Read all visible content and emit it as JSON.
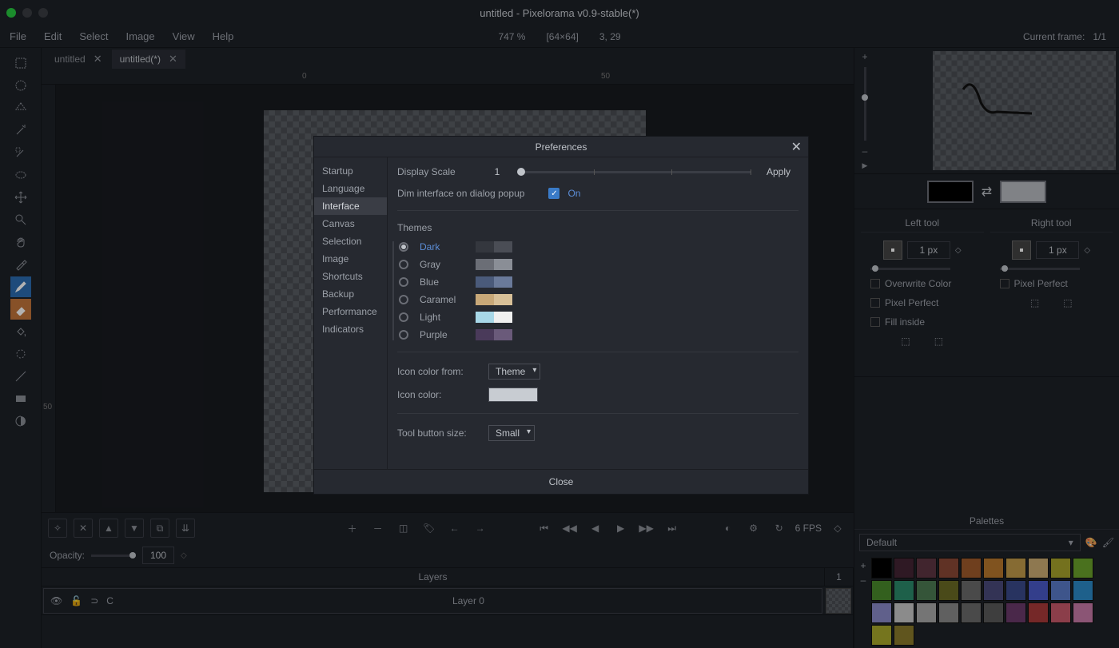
{
  "window": {
    "title": "untitled - Pixelorama v0.9-stable(*)"
  },
  "menu": {
    "file": "File",
    "edit": "Edit",
    "select": "Select",
    "image": "Image",
    "view": "View",
    "help": "Help",
    "zoom": "747 %",
    "dims": "[64×64]",
    "pos": "3, 29",
    "curframe_lbl": "Current frame:",
    "curframe_val": "1/1"
  },
  "tabs": [
    {
      "label": "untitled",
      "active": false
    },
    {
      "label": "untitled(*)",
      "active": true
    }
  ],
  "ruler": {
    "r0": "0",
    "r50": "50",
    "v50": "50"
  },
  "bottom": {
    "opacity_lbl": "Opacity:",
    "opacity_val": "100",
    "fps_lbl": "6 FPS",
    "layers_lbl": "Layers",
    "frame1": "1",
    "layer0": "Layer 0",
    "linkchar": "⊃",
    "chainchar": "C"
  },
  "right": {
    "left_tool": "Left tool",
    "right_tool": "Right tool",
    "px1": "1 px",
    "overwrite": "Overwrite Color",
    "pixel_perfect": "Pixel Perfect",
    "fill_inside": "Fill inside",
    "palettes": "Palettes",
    "default": "Default",
    "plus": "+",
    "minus": "–",
    "play": "▶"
  },
  "dialog": {
    "title": "Preferences",
    "sidebar": [
      "Startup",
      "Language",
      "Interface",
      "Canvas",
      "Selection",
      "Image",
      "Shortcuts",
      "Backup",
      "Performance",
      "Indicators"
    ],
    "selected_idx": 2,
    "display_scale_lbl": "Display Scale",
    "display_scale_val": "1",
    "apply": "Apply",
    "dim_lbl": "Dim interface on dialog popup",
    "on": "On",
    "themes_lbl": "Themes",
    "themes": [
      {
        "name": "Dark",
        "c1": "#34373e",
        "c2": "#4a4d55",
        "sel": true
      },
      {
        "name": "Gray",
        "c1": "#6b6e76",
        "c2": "#8a8e96"
      },
      {
        "name": "Blue",
        "c1": "#4a5a7a",
        "c2": "#6a7a9a"
      },
      {
        "name": "Caramel",
        "c1": "#c8a878",
        "c2": "#d8c098"
      },
      {
        "name": "Light",
        "c1": "#a8d8e8",
        "c2": "#f0f0f0"
      },
      {
        "name": "Purple",
        "c1": "#4a3a5a",
        "c2": "#6a5a7a"
      }
    ],
    "icon_from_lbl": "Icon color from:",
    "icon_from_val": "Theme",
    "icon_color_lbl": "Icon color:",
    "tool_size_lbl": "Tool button size:",
    "tool_size_val": "Small",
    "close": "Close"
  },
  "palette_colors": [
    "#000000",
    "#442434",
    "#5d3643",
    "#8a4836",
    "#a05b2c",
    "#b8772d",
    "#c19a49",
    "#ccad73",
    "#a6a22c",
    "#6aa22c",
    "#4a8a2c",
    "#2c8a6a",
    "#4c7a52",
    "#6a6a24",
    "#6a6a6a",
    "#4a4a7a",
    "#3a4a8a",
    "#4a5ac8",
    "#5a7ac8",
    "#2c8ac8",
    "#8a8ac8",
    "#c8c8c8",
    "#a8a8a8",
    "#8a8a8a",
    "#6a6a6a",
    "#5a5a5a",
    "#6a3a6a",
    "#a83a3a",
    "#c85a6a",
    "#c87aa8",
    "#a8a82c",
    "#8a7a2c"
  ]
}
